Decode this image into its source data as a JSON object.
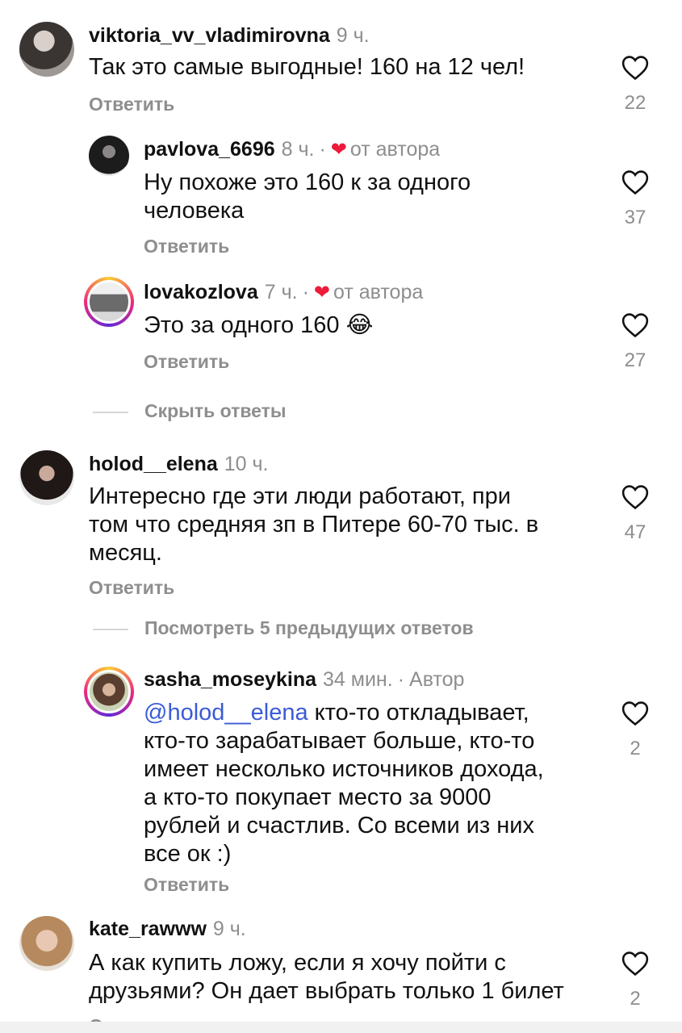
{
  "reply_label": "Ответить",
  "comments": [
    {
      "user": "viktoria_vv_vladimirovna",
      "time": "9 ч.",
      "lines": [
        "Так это самые выгодные! 160 на 12 чел!"
      ],
      "likes": "22"
    },
    {
      "user": "pavlova_6696",
      "time": "8 ч.",
      "liked_by_author": "от автора",
      "lines": [
        "Ну похоже это 160 к за одного",
        "человека"
      ],
      "likes": "37"
    },
    {
      "user": "lovakozlova",
      "time": "7 ч.",
      "liked_by_author": "от автора",
      "lines": [
        "Это за одного 160 😂"
      ],
      "likes": "27"
    },
    {
      "user": "holod__elena",
      "time": "10 ч.",
      "lines": [
        "Интересно где эти люди работают, при",
        "том что средняя зп в Питере 60-70 тыс. в",
        "месяц."
      ],
      "likes": "47"
    },
    {
      "user": "sasha_moseykina",
      "time": "34 мин.",
      "author_badge": "Автор",
      "mention": "@holod__elena",
      "lines": [
        " кто-то откладывает,",
        "кто-то зарабатывает больше, кто-то",
        "имеет несколько источников дохода,",
        "а кто-то покупает место за 9000",
        "рублей и счастлив. Со всеми из них",
        "все ок :)"
      ],
      "likes": "2"
    },
    {
      "user": "kate_rawww",
      "time": "9 ч.",
      "lines": [
        "А как купить ложу, если я хочу пойти с",
        "друзьями? Он дает выбрать только 1 билет"
      ],
      "likes": "2"
    }
  ],
  "hide_replies": "Скрыть ответы",
  "view_previous": "Посмотреть 5 предыдущих ответов",
  "colors": {
    "heart": "#ed1a3b",
    "mention": "#3b5bd6",
    "muted": "#8e8e8e"
  }
}
